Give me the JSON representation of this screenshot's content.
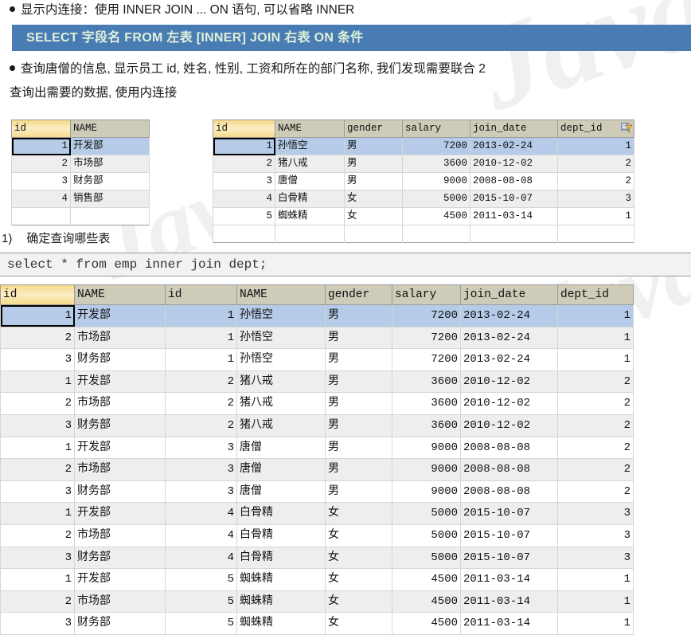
{
  "bullets": {
    "first": "显示内连接：使用 INNER JOIN ... ON 语句, 可以省略 INNER",
    "second": "查询唐僧的信息, 显示员工 id, 姓名, 性别, 工资和所在的部门名称, 我们发现需要联合 2",
    "second_cont": "查询出需要的数据, 使用内连接"
  },
  "syntax_banner": {
    "text": "SELECT 字段名 FROM 左表 [INNER] JOIN 右表 ON 条件",
    "background": "#4a7cb4",
    "color": "#dff0d8"
  },
  "step": {
    "number": "1)",
    "label": "确定查询哪些表"
  },
  "sql": {
    "statement": "select * from emp inner join dept;"
  },
  "dept_table": {
    "name": "dept",
    "columns": [
      "id",
      "NAME"
    ],
    "rows": [
      {
        "id": "1",
        "NAME": "开发部",
        "selected": true
      },
      {
        "id": "2",
        "NAME": "市场部",
        "selected": false
      },
      {
        "id": "3",
        "NAME": "财务部",
        "selected": false
      },
      {
        "id": "4",
        "NAME": "销售部",
        "selected": false
      }
    ]
  },
  "emp_table": {
    "name": "emp",
    "columns": [
      "id",
      "NAME",
      "gender",
      "salary",
      "join_date",
      "dept_id"
    ],
    "filter_icon": "filter-icon",
    "rows": [
      {
        "id": "1",
        "NAME": "孙悟空",
        "gender": "男",
        "salary": "7200",
        "join_date": "2013-02-24",
        "dept_id": "1",
        "selected": true
      },
      {
        "id": "2",
        "NAME": "猪八戒",
        "gender": "男",
        "salary": "3600",
        "join_date": "2010-12-02",
        "dept_id": "2",
        "selected": false
      },
      {
        "id": "3",
        "NAME": "唐僧",
        "gender": "男",
        "salary": "9000",
        "join_date": "2008-08-08",
        "dept_id": "2",
        "selected": false
      },
      {
        "id": "4",
        "NAME": "白骨精",
        "gender": "女",
        "salary": "5000",
        "join_date": "2015-10-07",
        "dept_id": "3",
        "selected": false
      },
      {
        "id": "5",
        "NAME": "蜘蛛精",
        "gender": "女",
        "salary": "4500",
        "join_date": "2011-03-14",
        "dept_id": "1",
        "selected": false
      }
    ]
  },
  "result_table": {
    "columns": [
      "id",
      "NAME",
      "id",
      "NAME",
      "gender",
      "salary",
      "join_date",
      "dept_id"
    ],
    "rows": [
      {
        "dept_id": "1",
        "dept_name": "开发部",
        "emp_id": "1",
        "emp_name": "孙悟空",
        "gender": "男",
        "salary": "7200",
        "join_date": "2013-02-24",
        "fk": "1",
        "selected": true
      },
      {
        "dept_id": "2",
        "dept_name": "市场部",
        "emp_id": "1",
        "emp_name": "孙悟空",
        "gender": "男",
        "salary": "7200",
        "join_date": "2013-02-24",
        "fk": "1",
        "selected": false
      },
      {
        "dept_id": "3",
        "dept_name": "财务部",
        "emp_id": "1",
        "emp_name": "孙悟空",
        "gender": "男",
        "salary": "7200",
        "join_date": "2013-02-24",
        "fk": "1",
        "selected": false
      },
      {
        "dept_id": "1",
        "dept_name": "开发部",
        "emp_id": "2",
        "emp_name": "猪八戒",
        "gender": "男",
        "salary": "3600",
        "join_date": "2010-12-02",
        "fk": "2",
        "selected": false
      },
      {
        "dept_id": "2",
        "dept_name": "市场部",
        "emp_id": "2",
        "emp_name": "猪八戒",
        "gender": "男",
        "salary": "3600",
        "join_date": "2010-12-02",
        "fk": "2",
        "selected": false
      },
      {
        "dept_id": "3",
        "dept_name": "财务部",
        "emp_id": "2",
        "emp_name": "猪八戒",
        "gender": "男",
        "salary": "3600",
        "join_date": "2010-12-02",
        "fk": "2",
        "selected": false
      },
      {
        "dept_id": "1",
        "dept_name": "开发部",
        "emp_id": "3",
        "emp_name": "唐僧",
        "gender": "男",
        "salary": "9000",
        "join_date": "2008-08-08",
        "fk": "2",
        "selected": false
      },
      {
        "dept_id": "2",
        "dept_name": "市场部",
        "emp_id": "3",
        "emp_name": "唐僧",
        "gender": "男",
        "salary": "9000",
        "join_date": "2008-08-08",
        "fk": "2",
        "selected": false
      },
      {
        "dept_id": "3",
        "dept_name": "财务部",
        "emp_id": "3",
        "emp_name": "唐僧",
        "gender": "男",
        "salary": "9000",
        "join_date": "2008-08-08",
        "fk": "2",
        "selected": false
      },
      {
        "dept_id": "1",
        "dept_name": "开发部",
        "emp_id": "4",
        "emp_name": "白骨精",
        "gender": "女",
        "salary": "5000",
        "join_date": "2015-10-07",
        "fk": "3",
        "selected": false
      },
      {
        "dept_id": "2",
        "dept_name": "市场部",
        "emp_id": "4",
        "emp_name": "白骨精",
        "gender": "女",
        "salary": "5000",
        "join_date": "2015-10-07",
        "fk": "3",
        "selected": false
      },
      {
        "dept_id": "3",
        "dept_name": "财务部",
        "emp_id": "4",
        "emp_name": "白骨精",
        "gender": "女",
        "salary": "5000",
        "join_date": "2015-10-07",
        "fk": "3",
        "selected": false
      },
      {
        "dept_id": "1",
        "dept_name": "开发部",
        "emp_id": "5",
        "emp_name": "蜘蛛精",
        "gender": "女",
        "salary": "4500",
        "join_date": "2011-03-14",
        "fk": "1",
        "selected": false
      },
      {
        "dept_id": "2",
        "dept_name": "市场部",
        "emp_id": "5",
        "emp_name": "蜘蛛精",
        "gender": "女",
        "salary": "4500",
        "join_date": "2011-03-14",
        "fk": "1",
        "selected": false
      },
      {
        "dept_id": "3",
        "dept_name": "财务部",
        "emp_id": "5",
        "emp_name": "蜘蛛精",
        "gender": "女",
        "salary": "4500",
        "join_date": "2011-03-14",
        "fk": "1",
        "selected": false
      }
    ]
  },
  "watermark": {
    "text": "Java"
  }
}
